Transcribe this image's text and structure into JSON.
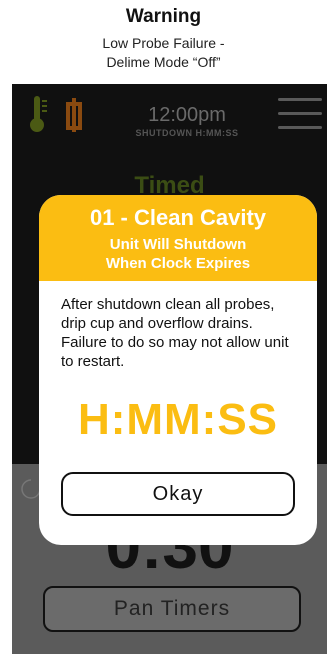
{
  "caption": {
    "title": "Warning",
    "line1": "Low Probe Failure -",
    "line2": "Delime Mode “Off”"
  },
  "device": {
    "clock": "12:00pm",
    "shutdown_label": "SHUTDOWN H:MM:SS",
    "mode_label": "Timed",
    "big_time": "0:30",
    "pan_timers_label": "Pan Timers"
  },
  "modal": {
    "title": "01 - Clean Cavity",
    "subtitle_line1": "Unit Will Shutdown",
    "subtitle_line2": "When Clock Expires",
    "body": "After shutdown clean all probes, drip cup and overflow drains. Failure to do so may not allow unit to restart.",
    "countdown": "H:MM:SS",
    "okay_label": "Okay"
  },
  "colors": {
    "accent": "#fbbd12",
    "therm_icon": "#4b5a14",
    "door_icon": "#8a4a10",
    "device_bg": "#101010",
    "panel_bg": "#5b5b5b"
  },
  "icons": [
    "thermometer-icon",
    "door-icon",
    "menu-icon",
    "dial-icon"
  ]
}
